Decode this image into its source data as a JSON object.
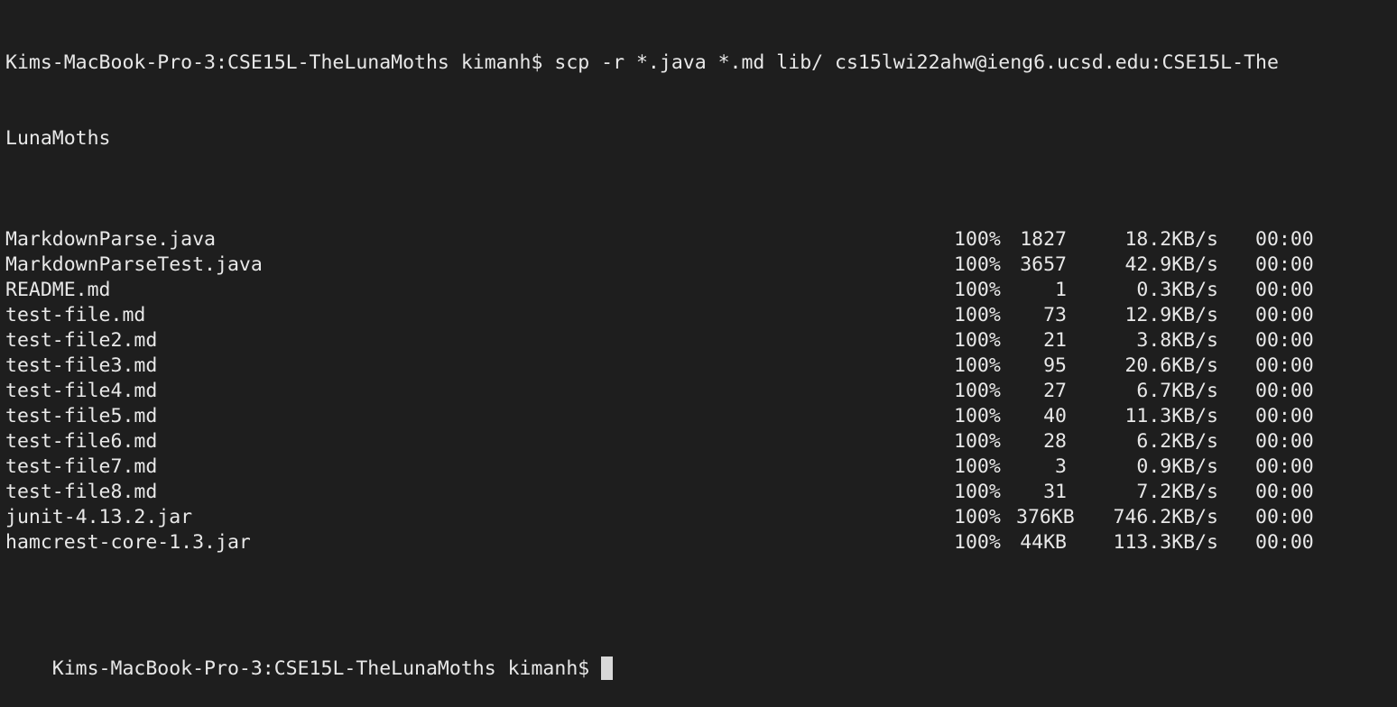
{
  "command": {
    "line1": "Kims-MacBook-Pro-3:CSE15L-TheLunaMoths kimanh$ scp -r *.java *.md lib/ cs15lwi22ahw@ieng6.ucsd.edu:CSE15L-The",
    "line2": "LunaMoths"
  },
  "transfers": [
    {
      "name": "MarkdownParse.java",
      "percent": "100%",
      "size": "1827",
      "rate": "18.2KB/s",
      "eta": "00:00"
    },
    {
      "name": "MarkdownParseTest.java",
      "percent": "100%",
      "size": "3657",
      "rate": "42.9KB/s",
      "eta": "00:00"
    },
    {
      "name": "README.md",
      "percent": "100%",
      "size": "1",
      "rate": "0.3KB/s",
      "eta": "00:00"
    },
    {
      "name": "test-file.md",
      "percent": "100%",
      "size": "73",
      "rate": "12.9KB/s",
      "eta": "00:00"
    },
    {
      "name": "test-file2.md",
      "percent": "100%",
      "size": "21",
      "rate": "3.8KB/s",
      "eta": "00:00"
    },
    {
      "name": "test-file3.md",
      "percent": "100%",
      "size": "95",
      "rate": "20.6KB/s",
      "eta": "00:00"
    },
    {
      "name": "test-file4.md",
      "percent": "100%",
      "size": "27",
      "rate": "6.7KB/s",
      "eta": "00:00"
    },
    {
      "name": "test-file5.md",
      "percent": "100%",
      "size": "40",
      "rate": "11.3KB/s",
      "eta": "00:00"
    },
    {
      "name": "test-file6.md",
      "percent": "100%",
      "size": "28",
      "rate": "6.2KB/s",
      "eta": "00:00"
    },
    {
      "name": "test-file7.md",
      "percent": "100%",
      "size": "3",
      "rate": "0.9KB/s",
      "eta": "00:00"
    },
    {
      "name": "test-file8.md",
      "percent": "100%",
      "size": "31",
      "rate": "7.2KB/s",
      "eta": "00:00"
    },
    {
      "name": "junit-4.13.2.jar",
      "percent": "100%",
      "size": "376KB",
      "rate": "746.2KB/s",
      "eta": "00:00"
    },
    {
      "name": "hamcrest-core-1.3.jar",
      "percent": "100%",
      "size": "44KB",
      "rate": "113.3KB/s",
      "eta": "00:00"
    }
  ],
  "prompt": "Kims-MacBook-Pro-3:CSE15L-TheLunaMoths kimanh$",
  "colors": {
    "background": "#1e1e1e",
    "text": "#e8e8e8",
    "cursor": "#d8d8d8"
  }
}
